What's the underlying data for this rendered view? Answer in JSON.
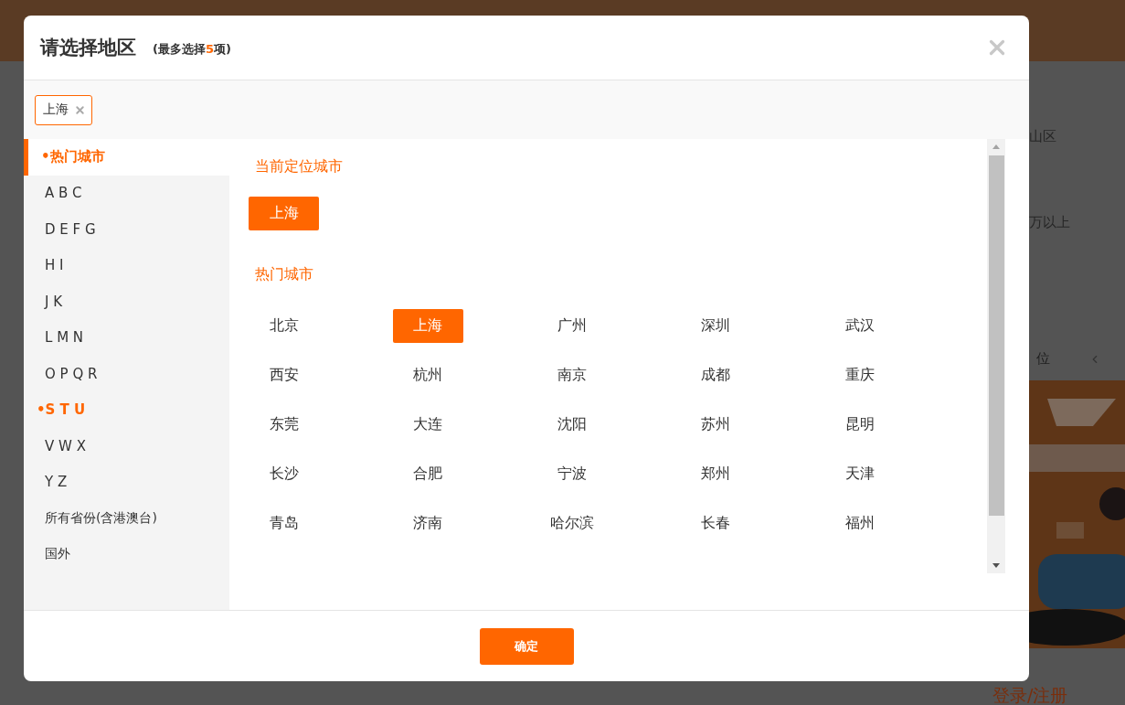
{
  "background": {
    "right_texts": [
      "山区",
      "万以上",
      "位"
    ],
    "login_link": "登录/注册"
  },
  "dialog": {
    "title": "请选择地区",
    "hint": "(最多选择**5**项)",
    "selected_tags": [
      {
        "label": "上海"
      }
    ],
    "sidebar": [
      {
        "label": "•热门城市",
        "selected": true,
        "active": true
      },
      {
        "label": "A B C",
        "selected": false,
        "active": false
      },
      {
        "label": "D E F G",
        "selected": false,
        "active": false
      },
      {
        "label": "H I",
        "selected": false,
        "active": false
      },
      {
        "label": "J K",
        "selected": false,
        "active": false
      },
      {
        "label": "L M N",
        "selected": false,
        "active": false
      },
      {
        "label": "O P Q R",
        "selected": false,
        "active": false
      },
      {
        "label": "•S T U",
        "selected": false,
        "active": true
      },
      {
        "label": "V W X",
        "selected": false,
        "active": false
      },
      {
        "label": "Y Z",
        "selected": false,
        "active": false
      },
      {
        "label": "所有省份(含港澳台)",
        "selected": false,
        "active": false
      },
      {
        "label": "国外",
        "selected": false,
        "active": false
      }
    ],
    "current_city": {
      "heading": "当前定位城市",
      "city": "上海"
    },
    "hot_cities": {
      "heading": "热门城市",
      "cities": [
        {
          "name": "北京",
          "selected": false
        },
        {
          "name": "上海",
          "selected": true
        },
        {
          "name": "广州",
          "selected": false
        },
        {
          "name": "深圳",
          "selected": false
        },
        {
          "name": "武汉",
          "selected": false
        },
        {
          "name": "西安",
          "selected": false
        },
        {
          "name": "杭州",
          "selected": false
        },
        {
          "name": "南京",
          "selected": false
        },
        {
          "name": "成都",
          "selected": false
        },
        {
          "name": "重庆",
          "selected": false
        },
        {
          "name": "东莞",
          "selected": false
        },
        {
          "name": "大连",
          "selected": false
        },
        {
          "name": "沈阳",
          "selected": false
        },
        {
          "name": "苏州",
          "selected": false
        },
        {
          "name": "昆明",
          "selected": false
        },
        {
          "name": "长沙",
          "selected": false
        },
        {
          "name": "合肥",
          "selected": false
        },
        {
          "name": "宁波",
          "selected": false
        },
        {
          "name": "郑州",
          "selected": false
        },
        {
          "name": "天津",
          "selected": false
        },
        {
          "name": "青岛",
          "selected": false
        },
        {
          "name": "济南",
          "selected": false
        },
        {
          "name": "哈尔滨",
          "selected": false
        },
        {
          "name": "长春",
          "selected": false
        },
        {
          "name": "福州",
          "selected": false
        }
      ]
    },
    "confirm": "确定"
  }
}
